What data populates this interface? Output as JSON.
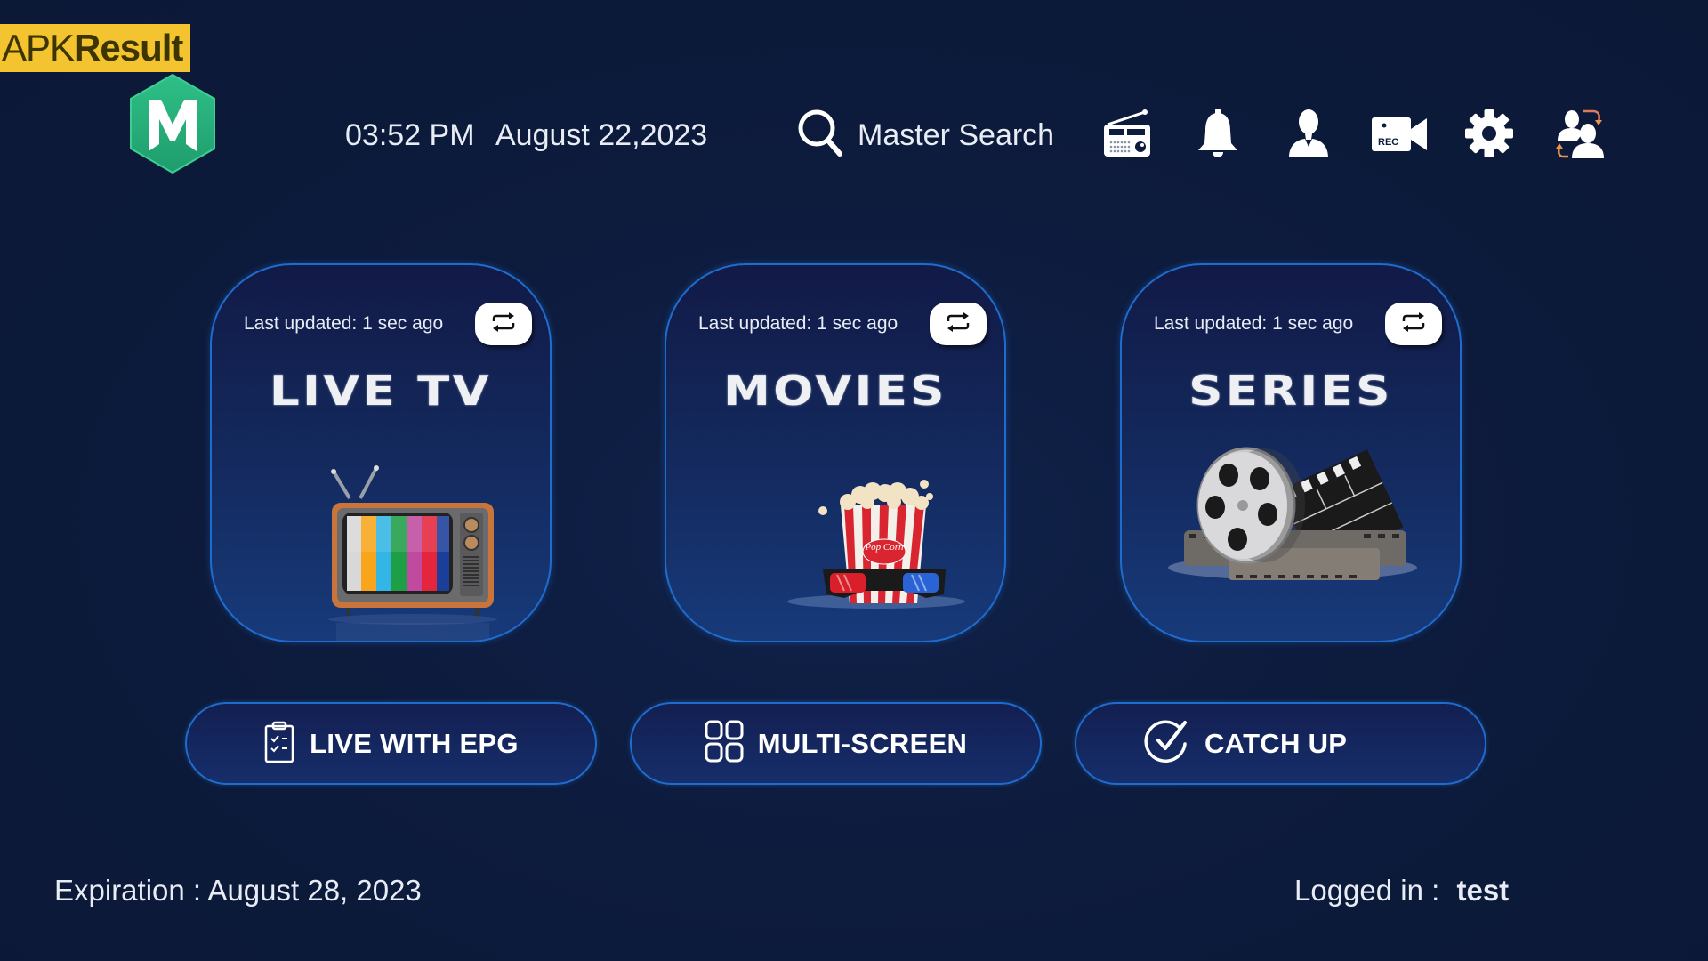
{
  "watermark": {
    "prefix": "APK",
    "suffix": "Result"
  },
  "app": {
    "logo_letter": "M",
    "brand_color": "#2bb17e"
  },
  "header": {
    "time": "03:52 PM",
    "date": "August 22,2023",
    "search_label": "Master Search",
    "icons": [
      "radio-icon",
      "notification-bell-icon",
      "user-profile-icon",
      "record-camera-icon",
      "settings-gear-icon",
      "switch-user-icon"
    ],
    "rec_badge": "REC"
  },
  "cards": [
    {
      "id": "live-tv",
      "title": "LIVE TV",
      "updated": "Last updated: 1 sec ago",
      "icon": "retro-tv-illustration"
    },
    {
      "id": "movies",
      "title": "MOVIES",
      "updated": "Last updated: 1 sec ago",
      "icon": "popcorn-3d-glasses-illustration",
      "popcorn_text": "Pop Corn"
    },
    {
      "id": "series",
      "title": "SERIES",
      "updated": "Last updated: 1 sec ago",
      "icon": "film-reel-clapperboard-illustration"
    }
  ],
  "actions": [
    {
      "id": "live-with-epg",
      "label": "LIVE WITH EPG",
      "icon": "clipboard-checklist-icon"
    },
    {
      "id": "multi-screen",
      "label": "MULTI-SCREEN",
      "icon": "grid-four-squares-icon"
    },
    {
      "id": "catch-up",
      "label": "CATCH UP",
      "icon": "circle-check-icon"
    }
  ],
  "footer": {
    "expiration_label": "Expiration : August 28, 2023",
    "logged_in_label": "Logged in :",
    "username": "test"
  },
  "colors": {
    "background": "#0d1b3d",
    "card_border": "#1f6ccf",
    "watermark_bg": "#f4c430",
    "accent_orange": "#e8944a"
  }
}
